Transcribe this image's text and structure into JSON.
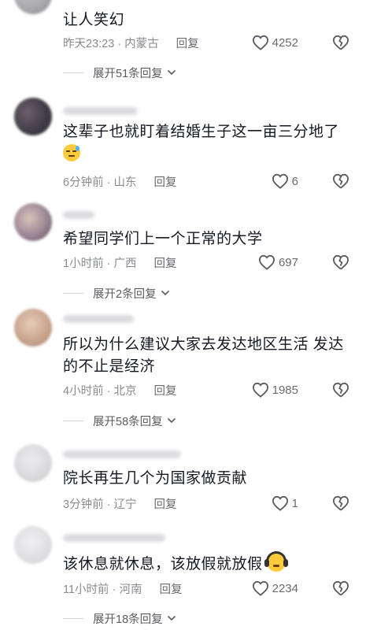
{
  "comments": [
    {
      "text": "让人笑幻",
      "time_location": "昨天23:23 · 内蒙古",
      "reply_label": "回复",
      "likes": "4252",
      "expand_label": "展开51条回复"
    },
    {
      "text": "这辈子也就盯着结婚生子这一亩三分地了",
      "emoji": "sweat-smile-icon",
      "time_location": "6分钟前 · 山东",
      "reply_label": "回复",
      "likes": "6"
    },
    {
      "text": "希望同学们上一个正常的大学",
      "time_location": "1小时前 · 广西",
      "reply_label": "回复",
      "likes": "697",
      "expand_label": "展开2条回复"
    },
    {
      "text": "所以为什么建议大家去发达地区生活 发达的不止是经济",
      "time_location": "4小时前 · 北京",
      "reply_label": "回复",
      "likes": "1985",
      "expand_label": "展开58条回复"
    },
    {
      "text": "院长再生几个为国家做贡献",
      "time_location": "3分钟前 · 辽宁",
      "reply_label": "回复",
      "likes": "1"
    },
    {
      "text": "该休息就休息，该放假就放假",
      "emoji": "headphone-face-icon",
      "time_location": "11小时前 · 河南",
      "reply_label": "回复",
      "likes": "2234",
      "expand_label": "展开18条回复"
    }
  ],
  "colors": {
    "text": "#161823",
    "meta": "#8a8b91",
    "icon": "#5b5c62"
  }
}
